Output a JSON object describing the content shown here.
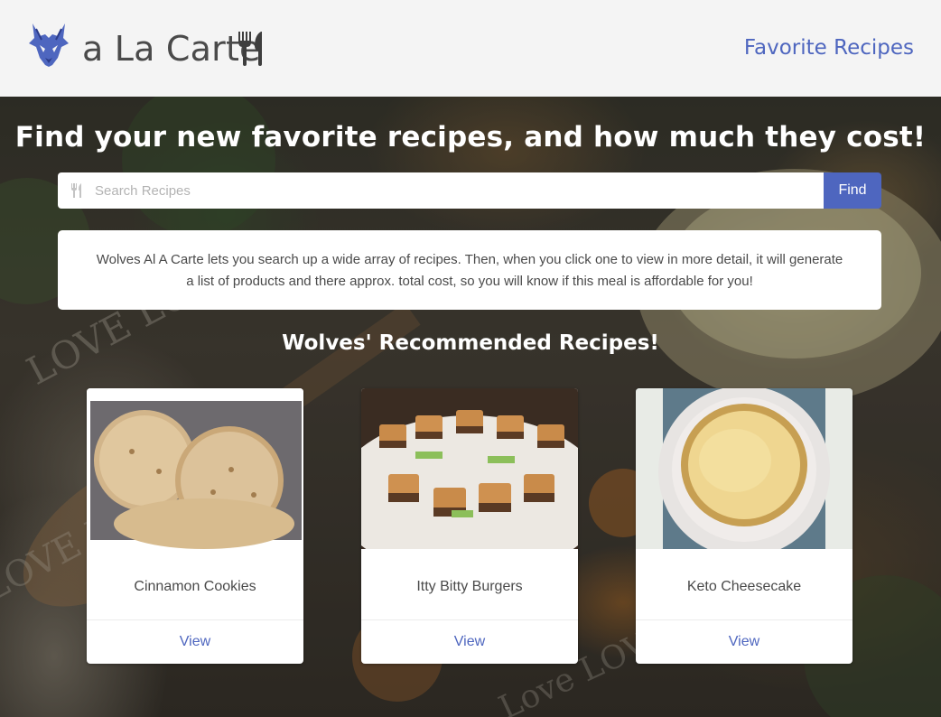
{
  "header": {
    "brand": "a La Carte",
    "nav_favorites": "Favorite Recipes"
  },
  "hero": {
    "title": "Find your new favorite recipes, and how much they cost!",
    "search_placeholder": "Search Recipes",
    "search_value": "",
    "find_label": "Find",
    "description": "Wolves Al A Carte lets you search up a wide array of recipes. Then, when you click one to view in more detail, it will generate a list of products and there approx. total cost, so you will know if this meal is affordable for you!",
    "section_title": "Wolves' Recommended Recipes!"
  },
  "recipes": [
    {
      "name": "Cinnamon Cookies",
      "view_label": "View",
      "image": "cookies-photo"
    },
    {
      "name": "Itty Bitty Burgers",
      "view_label": "View",
      "image": "mini-burgers-photo"
    },
    {
      "name": "Keto Cheesecake",
      "view_label": "View",
      "image": "cheesecake-photo"
    }
  ],
  "colors": {
    "accent": "#4e66bf",
    "header_bg": "#f4f4f4",
    "brand_text": "#4a4a4a"
  },
  "icons": [
    "wolf-logo-icon",
    "utensils-icon",
    "fork-knife-icon"
  ]
}
